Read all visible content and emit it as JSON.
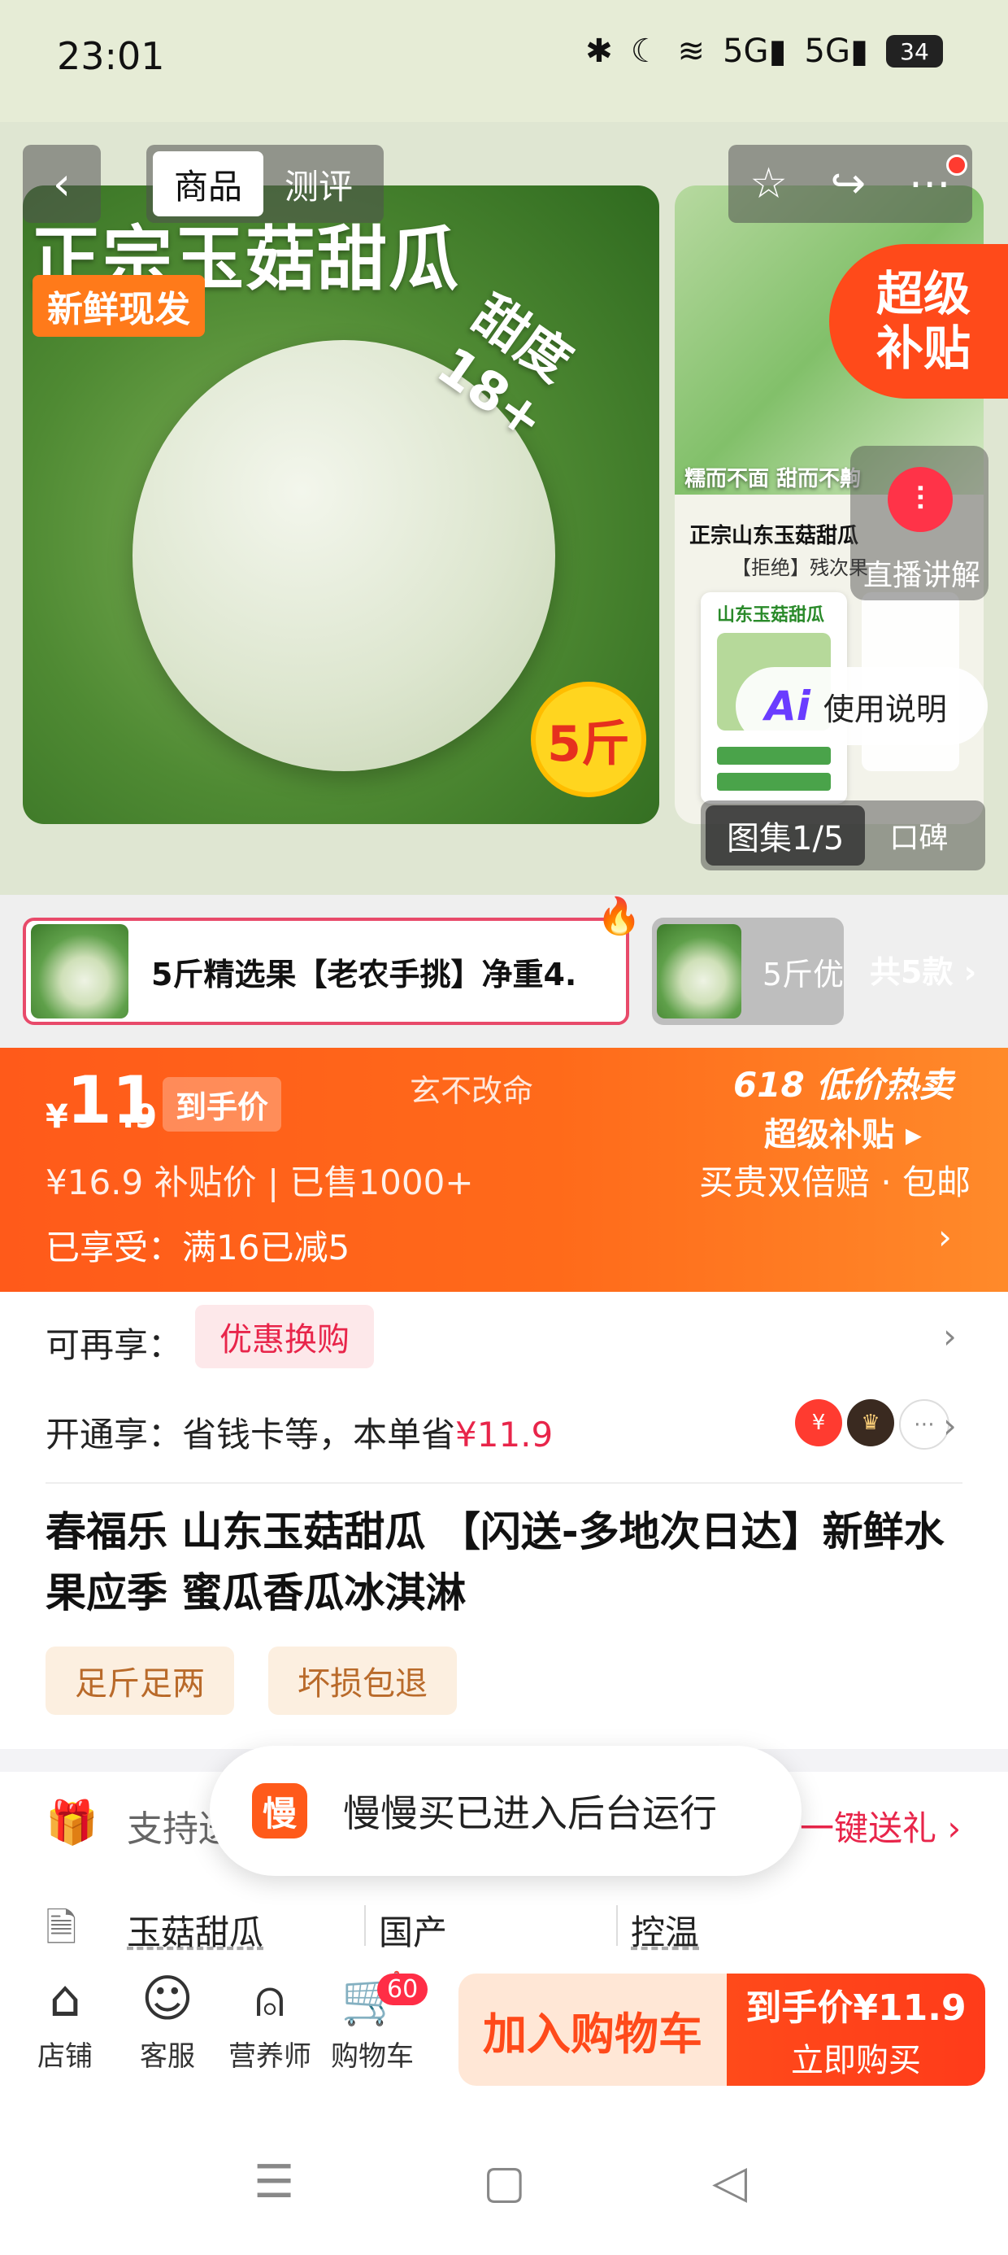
{
  "status_bar": {
    "time": "23:01",
    "icons": [
      "bluetooth-icon",
      "moon-icon",
      "wifi-icon",
      "signal-5g-icon",
      "signal-5g-icon"
    ],
    "battery": "34"
  },
  "gallery": {
    "main_title": "正宗玉菇甜瓜",
    "tag": "新鲜现发",
    "sweetness": "甜度18+",
    "weight": "5斤",
    "side_caption1": "糯而不面 甜而不齁",
    "side_caption2": "正宗山东玉菇甜瓜",
    "side_caption3": "【拒绝】残次果",
    "side_card_title": "山东玉菇甜瓜",
    "super_subsidy": [
      "超级",
      "补贴"
    ],
    "tabs": [
      "商品",
      "测评"
    ],
    "live_label": "直播讲解",
    "ai_logo": "Ai",
    "ai_label": "使用说明",
    "pill_album": "图集1/5",
    "pill_review": "口碑"
  },
  "variants": {
    "selected": "5斤精选果【老农手挑】净重4.",
    "second": "5斤优",
    "total": "共5款 ›"
  },
  "price": {
    "symbol": "¥",
    "integer": "11",
    "decimal": ".9",
    "tag": "到手价",
    "watermark": "玄不改命",
    "promo_title": "618 低价热卖",
    "promo_sub": "超级补贴 ▸",
    "guarantee": "买贵双倍赔 · 包邮",
    "original": "¥16.9  补贴价 | 已售1000+",
    "discount": "已享受：满16已减5"
  },
  "benefits": {
    "row1_label": "可再享：",
    "row1_tag": "优惠换购",
    "row2_label": "开通享：省钱卡等，本单省",
    "row2_price": "¥11.9"
  },
  "product": {
    "title": "春福乐 山东玉菇甜瓜 【闪送-多地次日达】新鲜水果应季 蜜瓜香瓜冰淇淋",
    "features": [
      "足斤足两",
      "坏损包退"
    ]
  },
  "service": {
    "support": "支持送",
    "gift_link": "一键送礼 ›",
    "specs": [
      "玉菇甜瓜",
      "国产",
      "控温"
    ]
  },
  "toast": {
    "logo": "慢",
    "text": "慢慢买已进入后台运行"
  },
  "action_bar": {
    "items": [
      "店铺",
      "客服",
      "营养师",
      "购物车"
    ],
    "cart_count": "60",
    "add_to_cart": "加入购物车",
    "buy_line1": "到手价¥11.9",
    "buy_line2": "立即购买"
  },
  "colors": {
    "accent": "#ff5a1a",
    "red": "#e8254a",
    "feature_bg": "#fcefe0"
  }
}
